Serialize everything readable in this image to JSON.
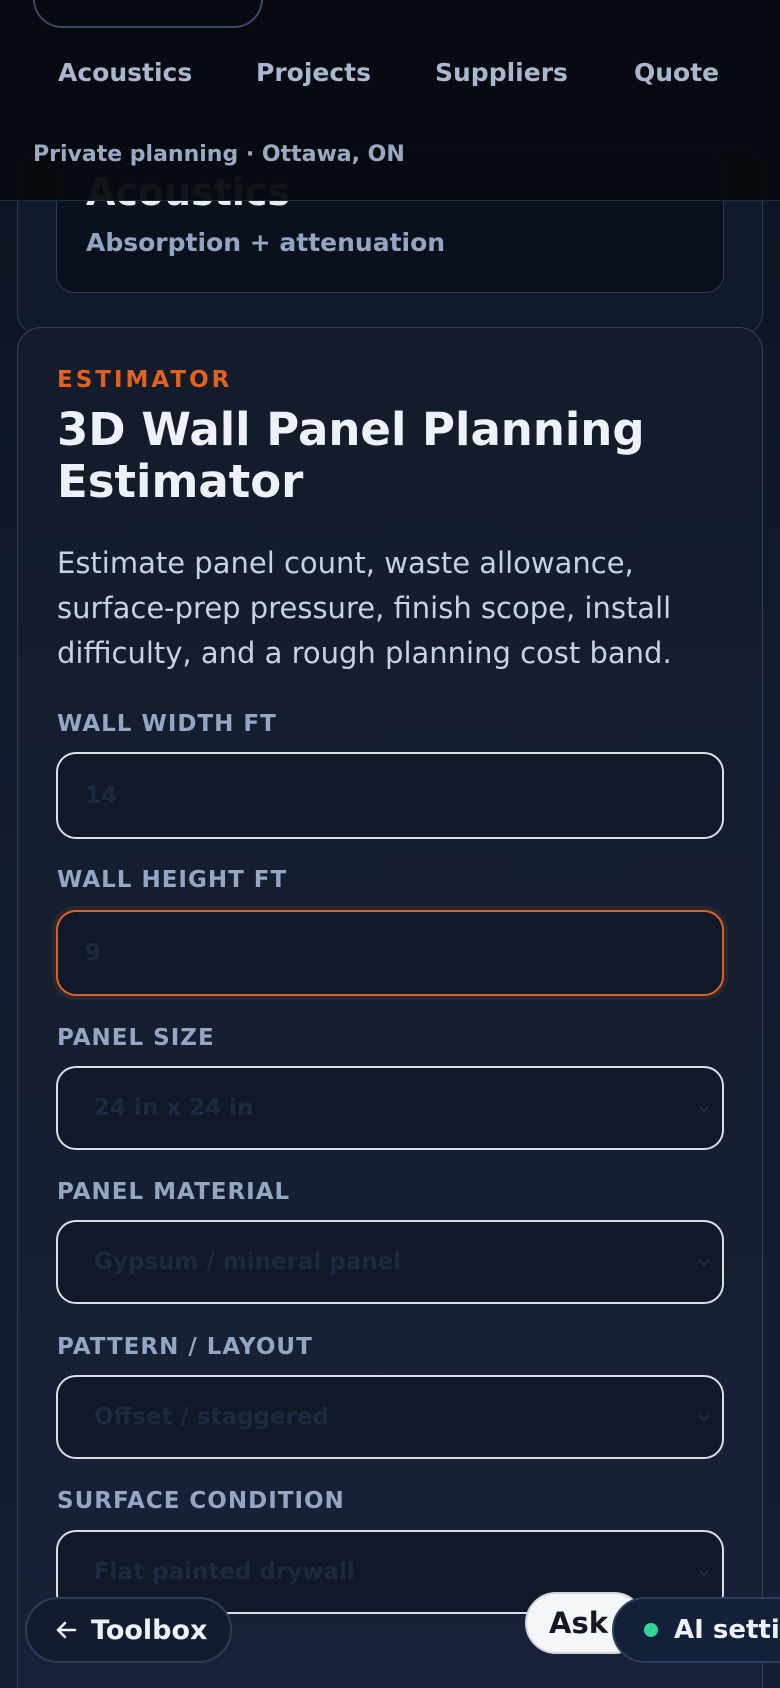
{
  "previous_card": {
    "title": "Acoustics",
    "subtitle": "Absorption + attenuation"
  },
  "nav": {
    "items": [
      {
        "label": "Acoustics"
      },
      {
        "label": "Projects"
      },
      {
        "label": "Suppliers"
      },
      {
        "label": "Quote"
      }
    ],
    "context": "Private planning · Ottawa, ON"
  },
  "estimator": {
    "eyebrow": "ESTIMATOR",
    "title": "3D Wall Panel Planning Estimator",
    "description": "Estimate panel count, waste allowance, surface-prep pressure, finish scope, install difficulty, and a rough planning cost band.",
    "fields": {
      "wall_width": {
        "label": "WALL WIDTH FT",
        "value": "14"
      },
      "wall_height": {
        "label": "WALL HEIGHT FT",
        "value": "9"
      },
      "panel_size": {
        "label": "PANEL SIZE",
        "value": "24 in x 24 in"
      },
      "panel_material": {
        "label": "PANEL MATERIAL",
        "value": "Gypsum / mineral panel"
      },
      "pattern_layout": {
        "label": "PATTERN / LAYOUT",
        "value": "Offset / staggered"
      },
      "surface_condition": {
        "label": "SURFACE CONDITION",
        "value": "Flat painted drywall"
      }
    }
  },
  "floating": {
    "toolbox_label": "Toolbox",
    "ask_label": "Ask",
    "ai_settings_label": "AI settings"
  },
  "colors": {
    "accent": "#e0621e",
    "status_dot": "#34d399",
    "background": "#0e1624"
  }
}
